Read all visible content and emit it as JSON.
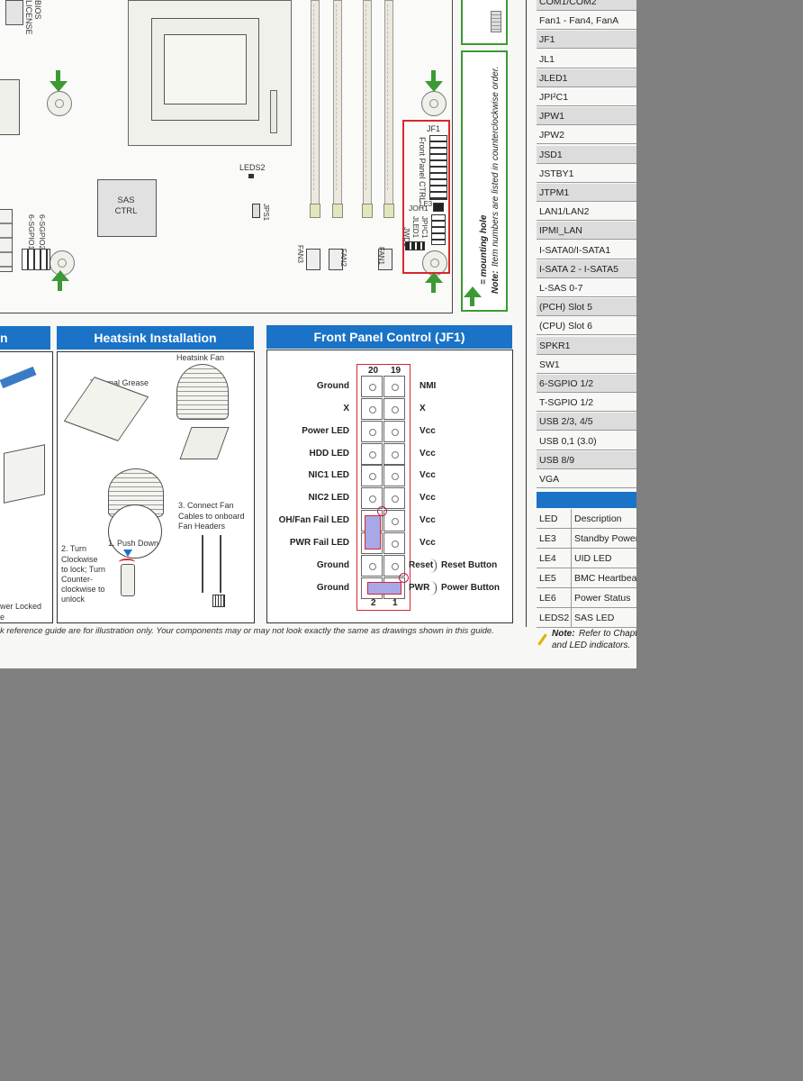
{
  "board": {
    "bios_label_1": "BIOS",
    "bios_label_2": "LICENSE",
    "leds2": "LEDS2",
    "sas_ctrl_1": "SAS",
    "sas_ctrl_2": "CTRL",
    "jps1": "JPS1",
    "sgpio2": "6-SGPIO2",
    "sgpio1": "6-SGPIO1",
    "fan3": "FAN3",
    "fan2": "FAN2",
    "fan1": "FAN1",
    "jf1": "JF1",
    "front_panel_ctrl": "Front Panel CTRL",
    "joh1": "JOH1",
    "jled1": "JLED1",
    "jpi2c1": "JPI²C1",
    "jwd1": "JWD1",
    "le3": "LE3"
  },
  "mounting_note": {
    "legend": "= mounting hole",
    "note_label": "Note:",
    "note_text": "Item numbers are listed in counterclockwise order."
  },
  "sections": {
    "left_partial_title": "n",
    "heatsink_title": "Heatsink Installation",
    "front_panel_title": "Front Panel Control (JF1)"
  },
  "heatsink": {
    "heatsink_fan": "Heatsink Fan",
    "thermal_grease": "Thermal Grease",
    "step3_lines": [
      "3. Connect Fan",
      "Cables to onboard",
      "Fan Headers"
    ],
    "step2_lines": [
      "2. Turn",
      "Clockwise",
      "to lock; Turn",
      "Counter-",
      "clockwise to",
      "unlock"
    ],
    "step1": "1. Push Down",
    "left_partial_1": "wer Locked",
    "left_partial_2": "e"
  },
  "jf1": {
    "top_left": "20",
    "top_right": "19",
    "bottom_left": "2",
    "bottom_right": "1",
    "left_labels": [
      "Ground",
      "X",
      "Power LED",
      "HDD LED",
      "NIC1 LED",
      "NIC2 LED",
      "OH/Fan Fail LED",
      "PWR Fail LED",
      "Ground",
      "Ground"
    ],
    "right_labels": [
      "NMI",
      "X",
      "Vcc",
      "Vcc",
      "Vcc",
      "Vcc",
      "Vcc",
      "Vcc",
      "Reset",
      "PWR"
    ],
    "reset_button": "Reset Button",
    "power_button": "Power Button"
  },
  "footer_text": "k reference guide are for illustration only. Your components may or may not look exactly the same as drawings shown in this guide.",
  "jumper_rows": [
    "COM1/COM2",
    "Fan1 - Fan4, FanA",
    "JF1",
    "JL1",
    "JLED1",
    "JPI²C1",
    "JPW1",
    "JPW2",
    "JSD1",
    "JSTBY1",
    "JTPM1",
    "LAN1/LAN2",
    "IPMI_LAN",
    "I-SATA0/I-SATA1",
    "I-SATA 2 - I-SATA5",
    "L-SAS 0-7",
    "(PCH) Slot 5",
    "(CPU) Slot 6",
    "SPKR1",
    "SW1",
    "6-SGPIO 1/2",
    "T-SGPIO 1/2",
    "USB 2/3, 4/5",
    "USB 0,1 (3.0)",
    "USB 8/9",
    "VGA"
  ],
  "led_table": {
    "header": [
      "LED",
      "Description"
    ],
    "rows": [
      [
        "LE3",
        "Standby Power"
      ],
      [
        "LE4",
        "UID LED"
      ],
      [
        "LE5",
        "BMC Heartbeat"
      ],
      [
        "LE6",
        "Power Status"
      ],
      [
        "LEDS2",
        "SAS LED"
      ]
    ]
  },
  "bottom_note": {
    "label": "Note:",
    "line1": "Refer to Chapt",
    "line2": "and LED indicators."
  },
  "colors": {
    "accent_blue": "#1a73c6",
    "green": "#3c9a34",
    "red": "#d9262c",
    "jumper_fill": "#a8a8e8"
  }
}
